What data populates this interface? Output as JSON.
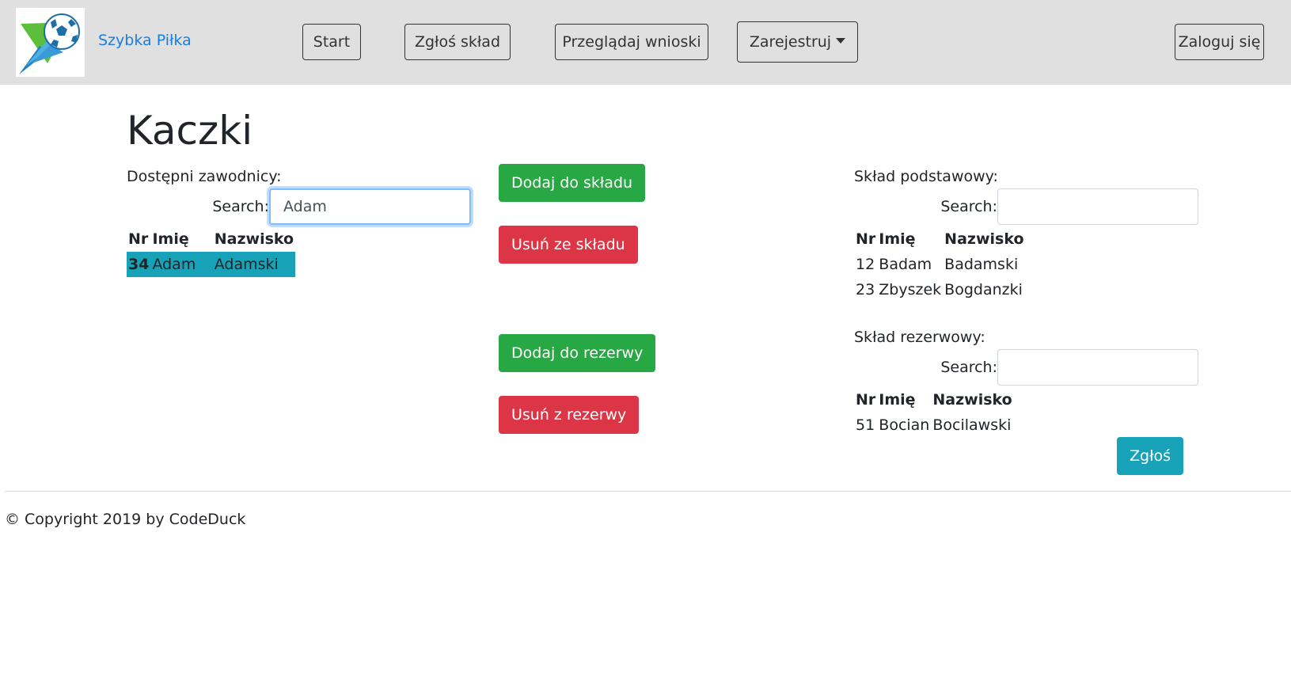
{
  "brand": {
    "name": "Szybka Piłka",
    "logo_icon": "soccer-ball-logo-icon"
  },
  "nav": {
    "start": "Start",
    "report_squad": "Zgłoś skład",
    "browse_requests": "Przeglądaj wnioski",
    "register": "Zarejestruj",
    "login": "Zaloguj się"
  },
  "page": {
    "title": "Kaczki"
  },
  "available": {
    "label": "Dostępni zawodnicy:",
    "search_label": "Search:",
    "search_value": "Adam",
    "columns": [
      "Nr",
      "Imię",
      "Nazwisko"
    ],
    "rows": [
      {
        "nr": "34",
        "first": "Adam",
        "last": "Adamski",
        "selected": true
      }
    ]
  },
  "actions": {
    "add_to_squad": "Dodaj do składu",
    "remove_from_squad": "Usuń ze składu",
    "add_to_reserve": "Dodaj do rezerwy",
    "remove_from_reserve": "Usuń z rezerwy"
  },
  "main_squad": {
    "label": "Skład podstawowy:",
    "search_label": "Search:",
    "search_value": "",
    "columns": [
      "Nr",
      "Imię",
      "Nazwisko"
    ],
    "rows": [
      {
        "nr": "12",
        "first": "Badam",
        "last": "Badamski"
      },
      {
        "nr": "23",
        "first": "Zbyszek",
        "last": "Bogdanzki"
      }
    ]
  },
  "reserve_squad": {
    "label": "Skład rezerwowy:",
    "search_label": "Search:",
    "search_value": "",
    "columns": [
      "Nr",
      "Imię",
      "Nazwisko"
    ],
    "rows": [
      {
        "nr": "51",
        "first": "Bocian",
        "last": "Bocilawski"
      }
    ]
  },
  "submit": "Zgłoś",
  "footer": {
    "copyright": "© Copyright 2019 by CodeDuck"
  },
  "colors": {
    "navbar_bg": "#e0e0e0",
    "brand_link": "#1a7ee0",
    "success": "#28a745",
    "danger": "#dc3545",
    "info": "#17a2b8"
  }
}
